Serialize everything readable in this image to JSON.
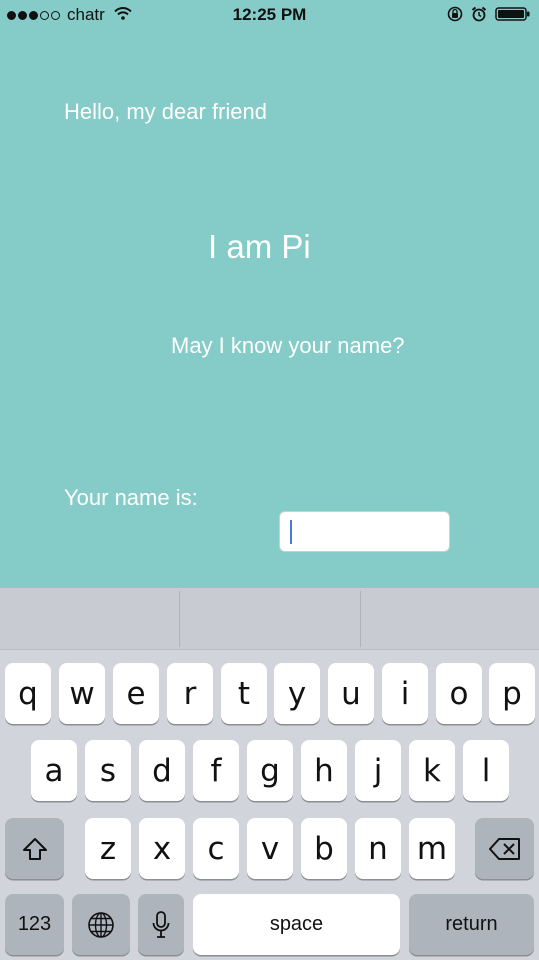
{
  "status_bar": {
    "carrier": "chatr",
    "time": "12:25 PM",
    "signal_dots_filled": 3,
    "signal_dots_total": 5
  },
  "content": {
    "greeting": "Hello,  my dear friend",
    "intro": "I am Pi",
    "question": "May I know your name?",
    "name_label": "Your name is:",
    "name_input_value": ""
  },
  "keyboard": {
    "row1": [
      "q",
      "w",
      "e",
      "r",
      "t",
      "y",
      "u",
      "i",
      "o",
      "p"
    ],
    "row2": [
      "a",
      "s",
      "d",
      "f",
      "g",
      "h",
      "j",
      "k",
      "l"
    ],
    "row3": [
      "z",
      "x",
      "c",
      "v",
      "b",
      "n",
      "m"
    ],
    "numbers_label": "123",
    "space_label": "space",
    "return_label": "return"
  },
  "colors": {
    "background": "#85cbc8",
    "text": "#ffffff",
    "keyboard_bg": "#d1d5db"
  }
}
